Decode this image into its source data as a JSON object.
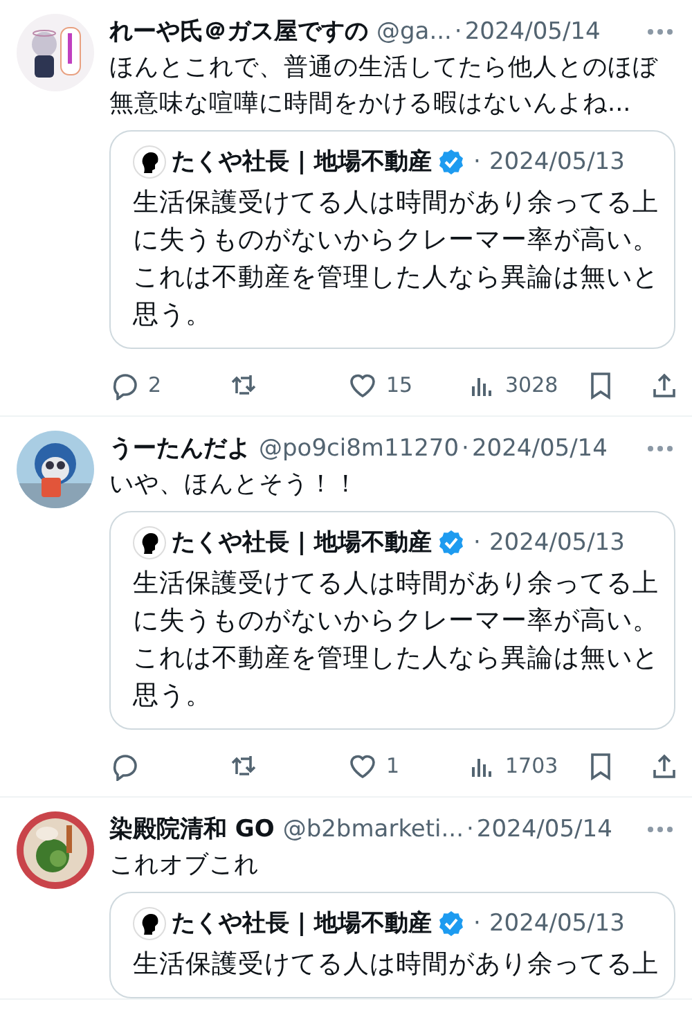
{
  "tweets": [
    {
      "avatar": {
        "kind": "picture"
      },
      "name": "れーや氏＠ガス屋ですの",
      "handle": "@ga...",
      "separator": "·",
      "date": "2024/05/14",
      "text_lines": [
        "ほんとこれで、普通の生活してたら他人とのほぼ",
        "無意味な喧嘩に時間をかける暇はないんよね..."
      ],
      "quote": {
        "name": "たくや社長 | 地場不動産",
        "verified": true,
        "separator": "·",
        "date": "2024/05/13",
        "text_lines": [
          "生活保護受けてる人は時間があり余ってる上",
          "に失うものがないからクレーマー率が高い。",
          "これは不動産を管理した人なら異論は無いと",
          "思う。"
        ]
      },
      "actions": {
        "replies": "2",
        "likes": "15",
        "views": "3028"
      }
    },
    {
      "avatar": {
        "kind": "picture"
      },
      "name": "うーたんだよ",
      "handle": "@po9ci8m11270",
      "separator": "·",
      "date": "2024/05/14",
      "text_lines": [
        "いや、ほんとそう！！"
      ],
      "quote": {
        "name": "たくや社長 | 地場不動産",
        "verified": true,
        "separator": "·",
        "date": "2024/05/13",
        "text_lines": [
          "生活保護受けてる人は時間があり余ってる上",
          "に失うものがないからクレーマー率が高い。",
          "これは不動産を管理した人なら異論は無いと",
          "思う。"
        ]
      },
      "actions": {
        "likes": "1",
        "views": "1703"
      }
    },
    {
      "avatar": {
        "kind": "picture"
      },
      "name": "染殿院清和 GO",
      "handle": "@b2bmarketi...",
      "separator": "·",
      "date": "2024/05/14",
      "text_lines": [
        "これオブこれ"
      ],
      "quote": {
        "name": "たくや社長 | 地場不動産",
        "verified": true,
        "separator": "·",
        "date": "2024/05/13",
        "text_lines": [
          "生活保護受けてる人は時間があり余ってる上"
        ]
      }
    }
  ]
}
